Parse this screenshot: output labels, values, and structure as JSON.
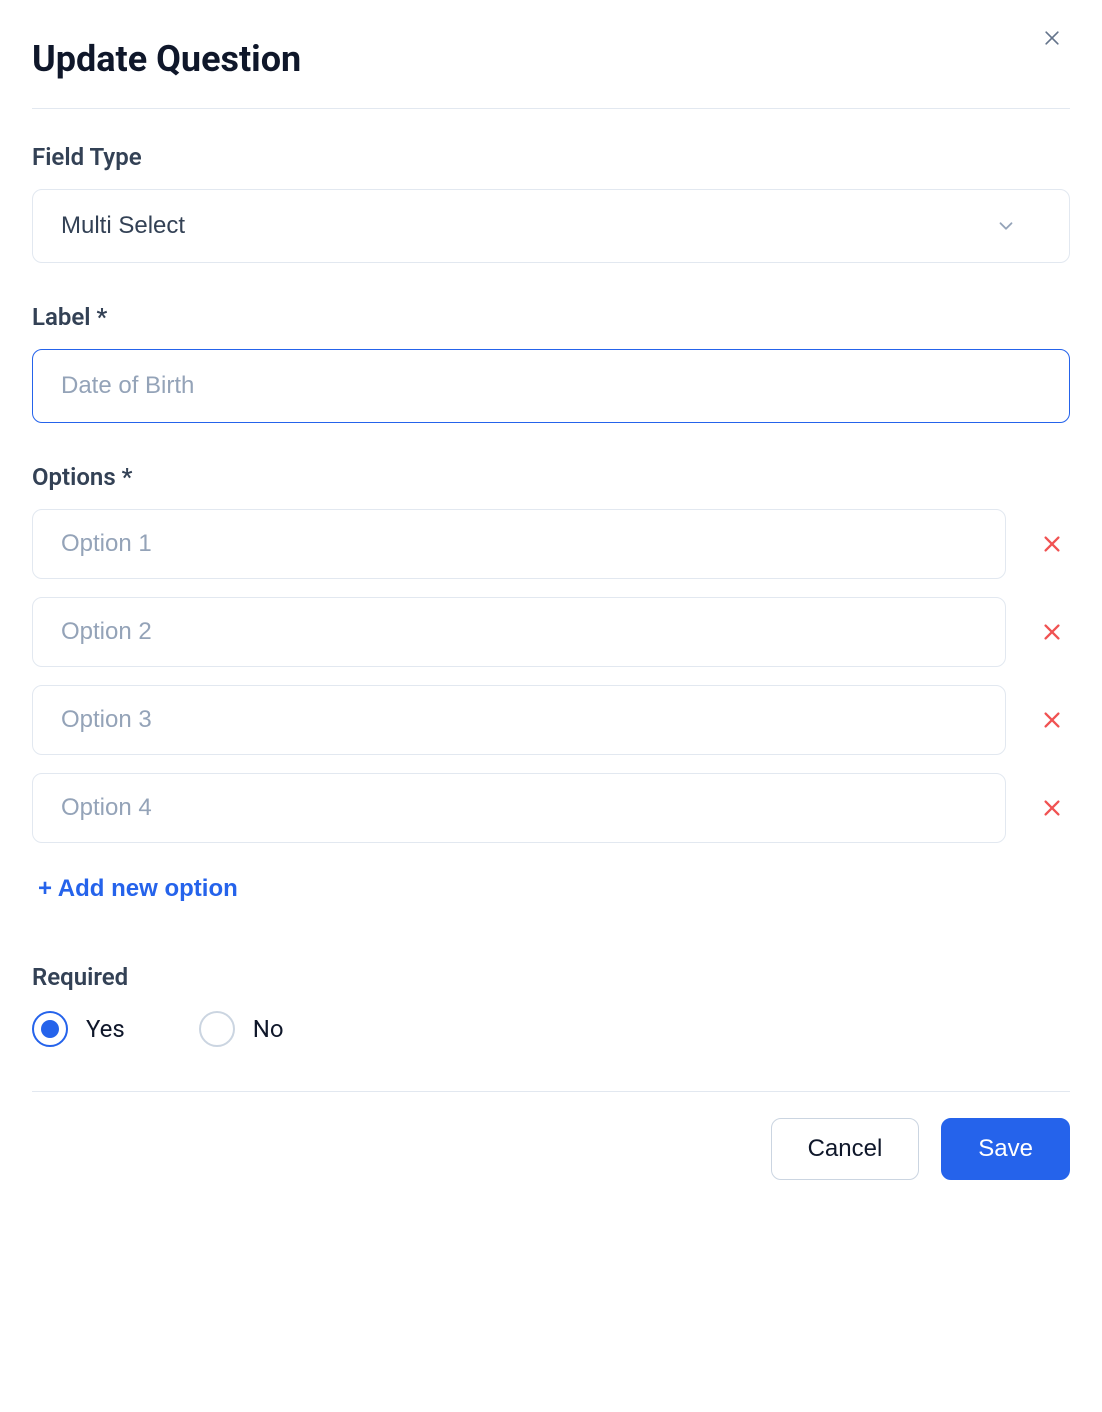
{
  "title": "Update Question",
  "fieldType": {
    "label": "Field Type",
    "value": "Multi Select"
  },
  "labelField": {
    "label": "Label *",
    "placeholder": "Date of Birth",
    "value": ""
  },
  "options": {
    "label": "Options *",
    "items": [
      {
        "placeholder": "Option 1",
        "value": ""
      },
      {
        "placeholder": "Option 2",
        "value": ""
      },
      {
        "placeholder": "Option 3",
        "value": ""
      },
      {
        "placeholder": "Option 4",
        "value": ""
      }
    ],
    "addNew": "+ Add new option"
  },
  "required": {
    "label": "Required",
    "yes": "Yes",
    "no": "No",
    "selected": "yes"
  },
  "buttons": {
    "cancel": "Cancel",
    "save": "Save"
  }
}
